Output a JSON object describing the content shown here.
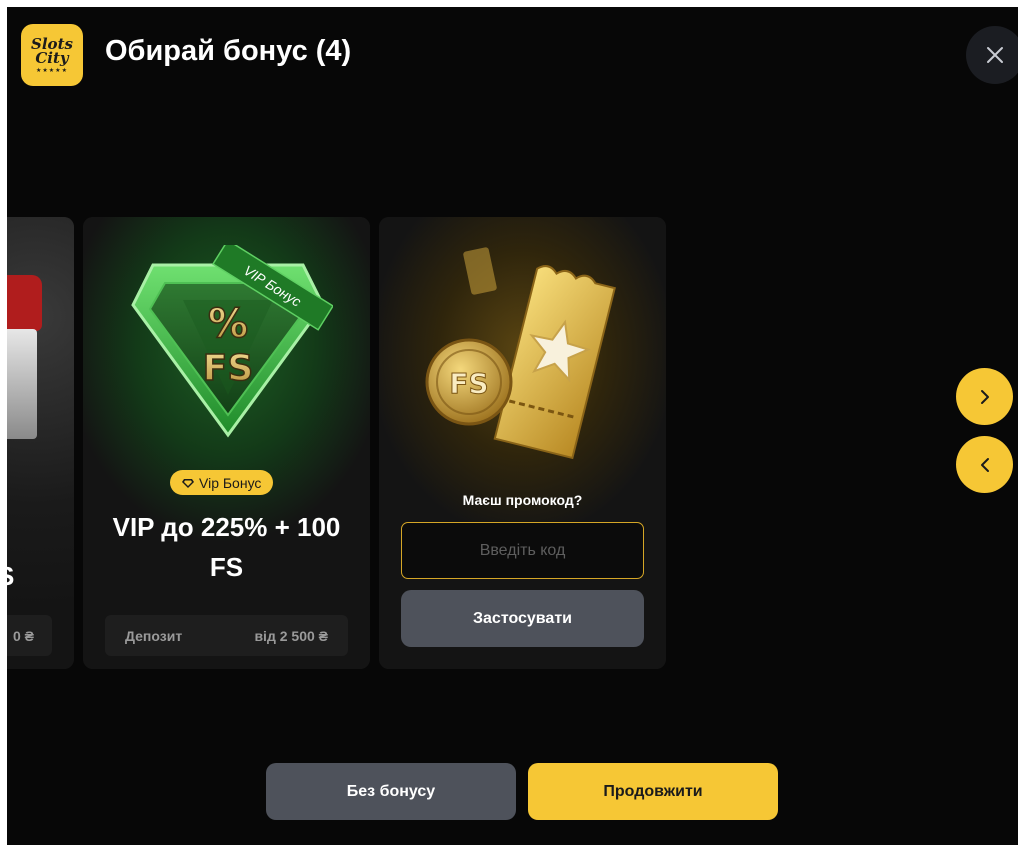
{
  "header": {
    "logo_line1": "Slots",
    "logo_line2": "City",
    "logo_stars": "★★★★★",
    "title": "Обирай бонус (4)"
  },
  "cards": {
    "left_partial": {
      "title_fragment": "S",
      "deposit_value_fragment": "0 ₴"
    },
    "vip": {
      "ribbon": "VIP Бонус",
      "emblem_top": "%",
      "emblem_bottom": "FS",
      "badge": "Vip Бонус",
      "offer_line1": "VIP до 225% + 100",
      "offer_line2": "FS",
      "deposit_label": "Депозит",
      "deposit_value": "від 2 500 ₴"
    },
    "promo": {
      "coin_text": "FS",
      "label": "Маєш промокод?",
      "input_value": "",
      "input_placeholder": "Введіть код",
      "apply_button": "Застосувати"
    }
  },
  "nav": {
    "next_icon": "chevron-right-icon",
    "prev_icon": "chevron-left-icon"
  },
  "footer": {
    "no_bonus_button": "Без бонусу",
    "continue_button": "Продовжити"
  },
  "colors": {
    "background": "#070707",
    "accent": "#f6c735",
    "card": "#141414",
    "secondary_button": "#4e525b",
    "input_border": "#d5a626"
  }
}
